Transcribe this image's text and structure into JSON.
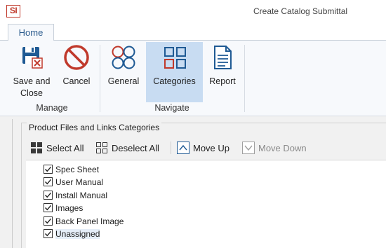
{
  "window": {
    "app_logo_text": "SI",
    "title": "Create Catalog Submittal"
  },
  "tabs": [
    {
      "label": "Home"
    }
  ],
  "ribbon": {
    "buttons": [
      {
        "label": "Save and Close",
        "icon": "save-close-icon"
      },
      {
        "label": "Cancel",
        "icon": "cancel-icon"
      },
      {
        "label": "General",
        "icon": "general-icon"
      },
      {
        "label": "Categories",
        "icon": "categories-icon",
        "selected": true
      },
      {
        "label": "Report",
        "icon": "report-icon"
      }
    ],
    "groups": [
      {
        "label": "Manage"
      },
      {
        "label": "Navigate"
      }
    ]
  },
  "categories_panel": {
    "title": "Product Files and Links Categories",
    "toolbar": {
      "select_all": "Select All",
      "deselect_all": "Deselect All",
      "move_up": "Move Up",
      "move_down": "Move Down"
    },
    "items": [
      {
        "label": "Spec Sheet",
        "checked": true
      },
      {
        "label": "User Manual",
        "checked": true
      },
      {
        "label": "Install Manual",
        "checked": true
      },
      {
        "label": "Images",
        "checked": true
      },
      {
        "label": "Back Panel Image",
        "checked": true
      },
      {
        "label": "Unassigned",
        "checked": true,
        "selected": true
      }
    ]
  },
  "colors": {
    "accent": "#2a5a8c",
    "cancel_red": "#c0392b",
    "icon_blue": "#1f5a94",
    "selected_bg": "#c8dcf2"
  }
}
